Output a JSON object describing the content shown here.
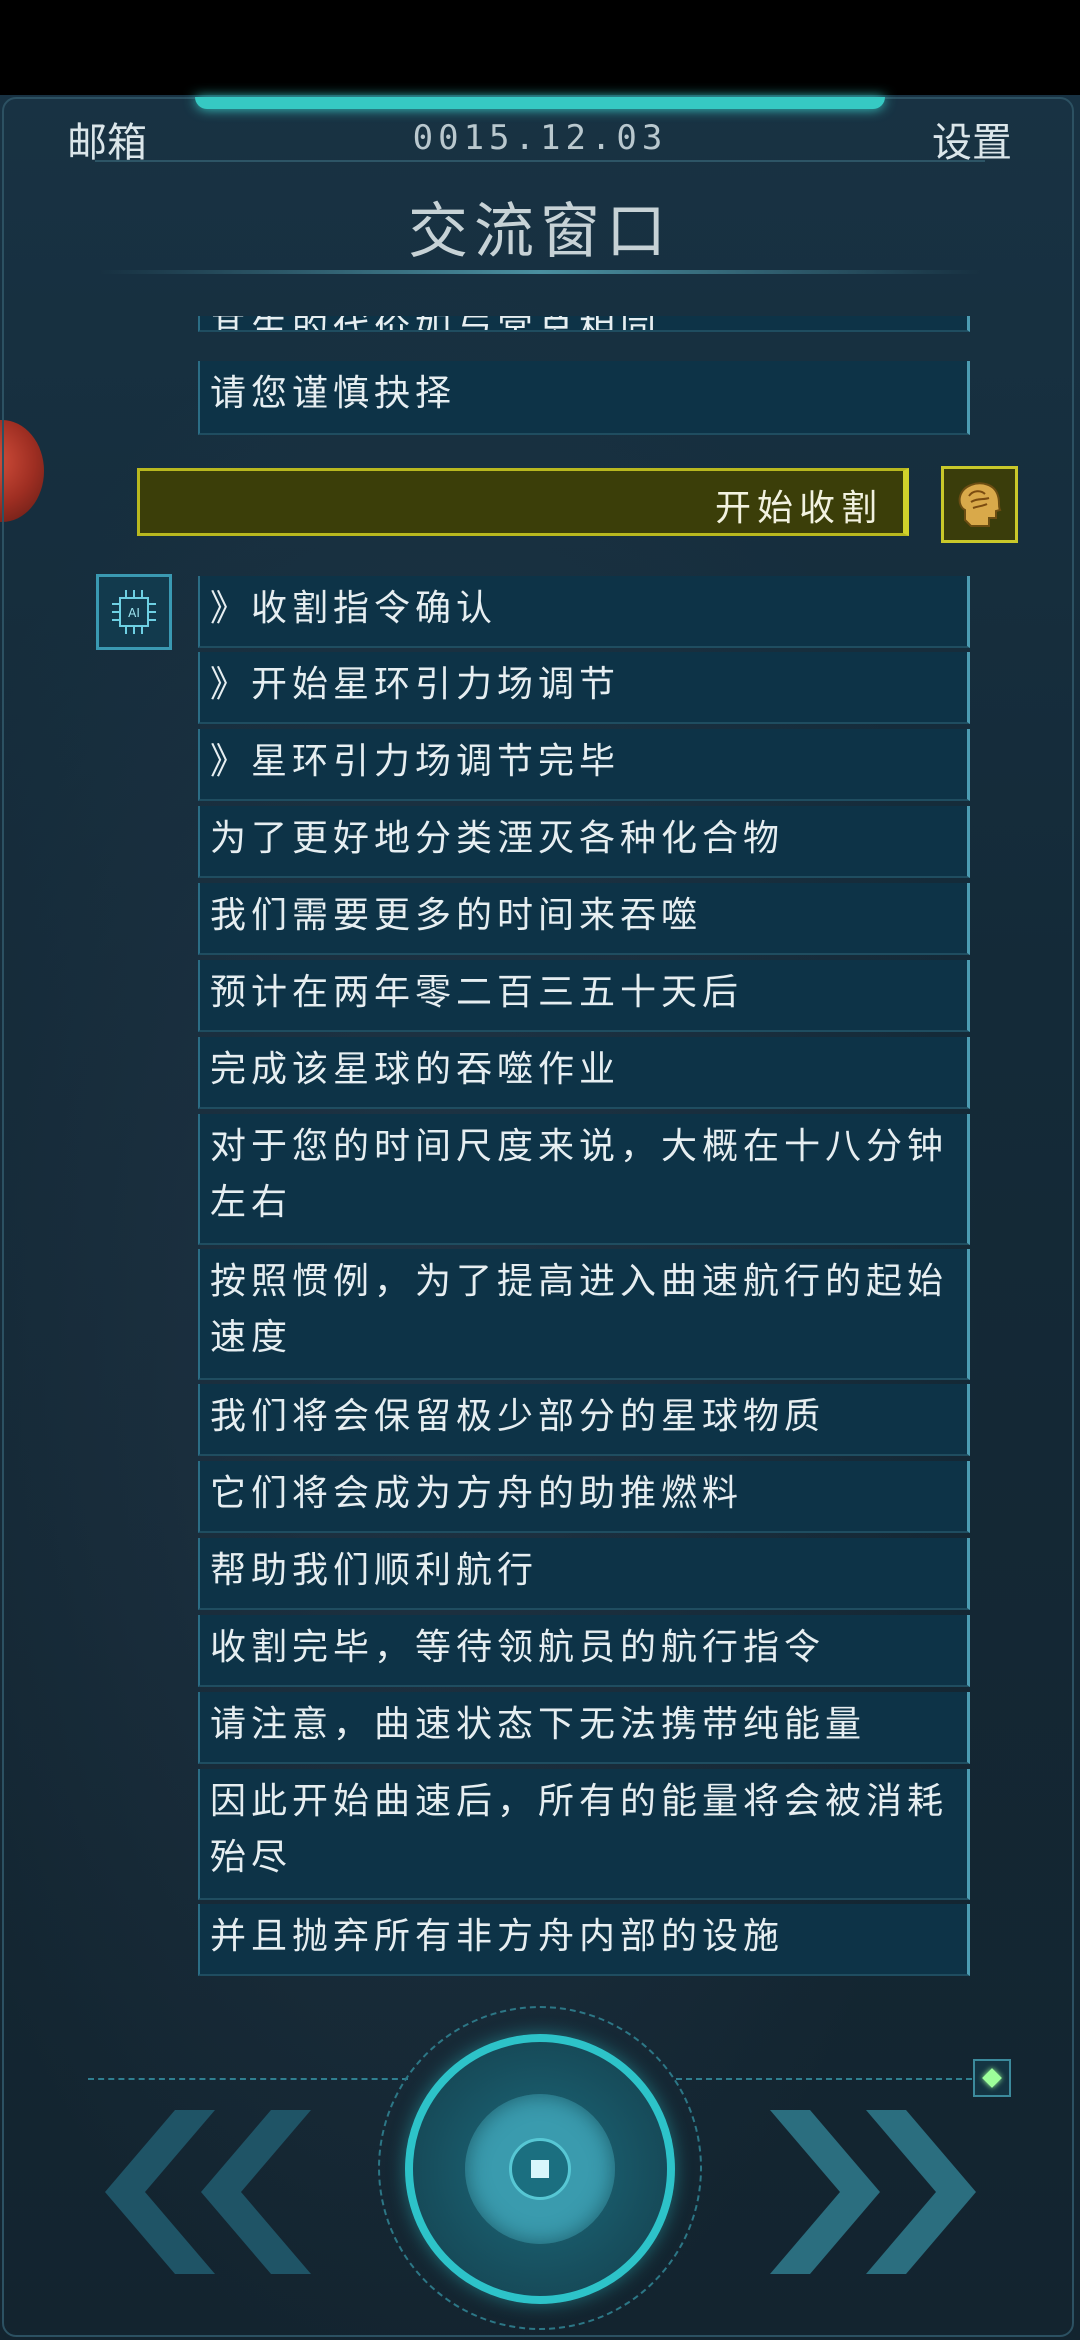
{
  "header": {
    "mailbox_label": "邮箱",
    "date": "0015.12.03",
    "settings_label": "设置",
    "title": "交流窗口"
  },
  "chat": {
    "partial_top": "其生的代价如与常总相同",
    "early_messages": [
      "请您谨慎抉择"
    ],
    "user_command": "开始收割",
    "ai_messages": [
      "》收割指令确认",
      "》开始星环引力场调节",
      "》星环引力场调节完毕",
      "为了更好地分类湮灭各种化合物",
      "我们需要更多的时间来吞噬",
      "预计在两年零二百三五十天后",
      "完成该星球的吞噬作业",
      "对于您的时间尺度来说，大概在十八分钟左右",
      "按照惯例，为了提高进入曲速航行的起始速度",
      "我们将会保留极少部分的星球物质",
      "它们将会成为方舟的助推燃料",
      "帮助我们顺利航行",
      "收割完毕，等待领航员的航行指令",
      "请注意，曲速状态下无法携带纯能量",
      "因此开始曲速后，所有的能量将会被消耗殆尽",
      "并且抛弃所有非方舟内部的设施"
    ]
  },
  "icons": {
    "ai_avatar": "ai-chip-icon",
    "ai_avatar_text": "AI",
    "user_avatar": "brain-head-icon",
    "prev": "double-chevron-left-icon",
    "next": "double-chevron-right-icon",
    "center": "stop-icon",
    "marker": "diamond-icon"
  },
  "colors": {
    "accent": "#2dc3c9",
    "user_bubble": "#3b3e09",
    "user_border": "#c9c82a",
    "ai_bubble": "#0d3347",
    "marker": "#9dff9a"
  }
}
